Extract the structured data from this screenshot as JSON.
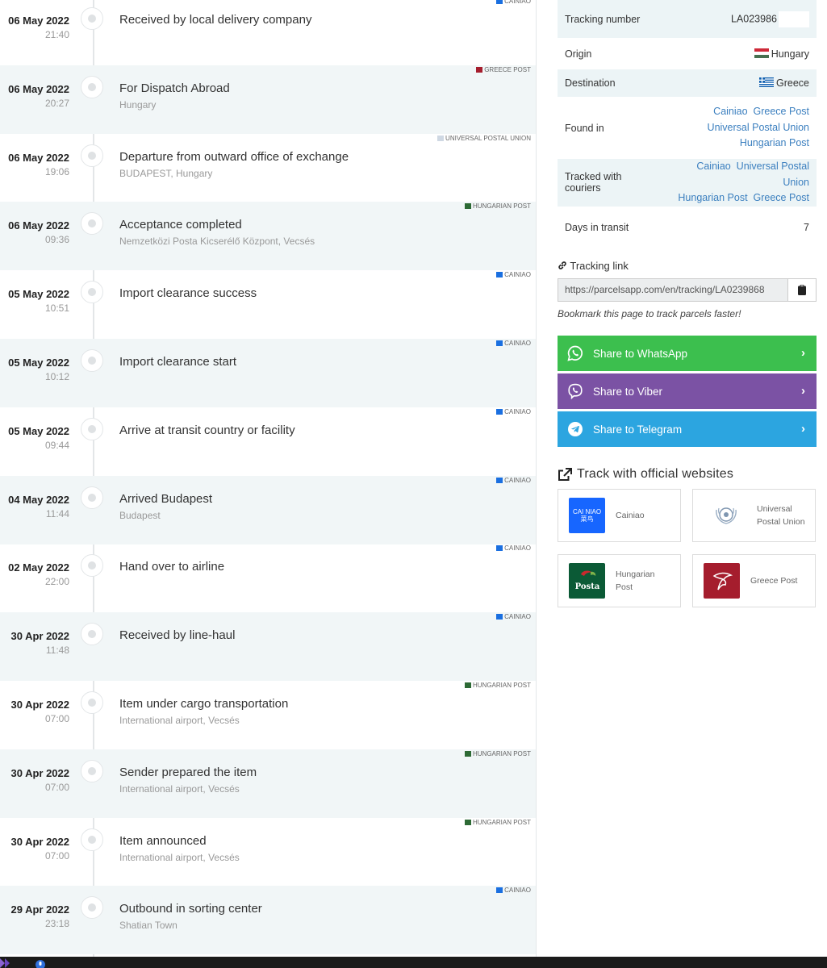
{
  "events": [
    {
      "date": "06 May 2022",
      "time": "21:40",
      "title": "Received by local delivery company",
      "location": "",
      "carrier": "CAINIAO",
      "carrier_color": "#1a6fe0"
    },
    {
      "date": "06 May 2022",
      "time": "20:27",
      "title": "For Dispatch Abroad",
      "location": "Hungary",
      "carrier": "GREECE POST",
      "carrier_color": "#a51d2d"
    },
    {
      "date": "06 May 2022",
      "time": "19:06",
      "title": "Departure from outward office of exchange",
      "location": "BUDAPEST, Hungary",
      "carrier": "UNIVERSAL POSTAL UNION",
      "carrier_color": "#cfd8e3"
    },
    {
      "date": "06 May 2022",
      "time": "09:36",
      "title": "Acceptance completed",
      "location": "Nemzetközi Posta Kicserélő Központ, Vecsés",
      "carrier": "HUNGARIAN POST",
      "carrier_color": "#2d6a35"
    },
    {
      "date": "05 May 2022",
      "time": "10:51",
      "title": "Import clearance success",
      "location": "",
      "carrier": "CAINIAO",
      "carrier_color": "#1a6fe0"
    },
    {
      "date": "05 May 2022",
      "time": "10:12",
      "title": "Import clearance start",
      "location": "",
      "carrier": "CAINIAO",
      "carrier_color": "#1a6fe0"
    },
    {
      "date": "05 May 2022",
      "time": "09:44",
      "title": "Arrive at transit country or facility",
      "location": "",
      "carrier": "CAINIAO",
      "carrier_color": "#1a6fe0"
    },
    {
      "date": "04 May 2022",
      "time": "11:44",
      "title": "Arrived Budapest",
      "location": "Budapest",
      "carrier": "CAINIAO",
      "carrier_color": "#1a6fe0"
    },
    {
      "date": "02 May 2022",
      "time": "22:00",
      "title": "Hand over to airline",
      "location": "",
      "carrier": "CAINIAO",
      "carrier_color": "#1a6fe0"
    },
    {
      "date": "30 Apr 2022",
      "time": "11:48",
      "title": "Received by line-haul",
      "location": "",
      "carrier": "CAINIAO",
      "carrier_color": "#1a6fe0"
    },
    {
      "date": "30 Apr 2022",
      "time": "07:00",
      "title": "Item under cargo transportation",
      "location": "International airport, Vecsés",
      "carrier": "HUNGARIAN POST",
      "carrier_color": "#2d6a35"
    },
    {
      "date": "30 Apr 2022",
      "time": "07:00",
      "title": "Sender prepared the item",
      "location": "International airport, Vecsés",
      "carrier": "HUNGARIAN POST",
      "carrier_color": "#2d6a35"
    },
    {
      "date": "30 Apr 2022",
      "time": "07:00",
      "title": "Item announced",
      "location": "International airport, Vecsés",
      "carrier": "HUNGARIAN POST",
      "carrier_color": "#2d6a35"
    },
    {
      "date": "29 Apr 2022",
      "time": "23:18",
      "title": "Outbound in sorting center",
      "location": "Shatian Town",
      "carrier": "CAINIAO",
      "carrier_color": "#1a6fe0"
    }
  ],
  "info": {
    "tracking_number_label": "Tracking number",
    "tracking_number": "LA023986",
    "origin_label": "Origin",
    "origin": "Hungary",
    "destination_label": "Destination",
    "destination": "Greece",
    "found_in_label": "Found in",
    "found_in": [
      "Cainiao",
      "Greece Post",
      "Universal Postal Union",
      "Hungarian Post"
    ],
    "tracked_with_label": "Tracked with couriers",
    "tracked_with": [
      "Cainiao",
      "Universal Postal Union",
      "Hungarian Post",
      "Greece Post"
    ],
    "days_label": "Days in transit",
    "days": "7"
  },
  "tracking_link": {
    "label": "Tracking link",
    "url": "https://parcelsapp.com/en/tracking/LA0239868",
    "hint": "Bookmark this page to track parcels faster!"
  },
  "share": {
    "whatsapp": "Share to WhatsApp",
    "viber": "Share to Viber",
    "telegram": "Share to Telegram",
    "whatsapp_color": "#3cbf4e",
    "viber_color": "#7b52a4",
    "telegram_color": "#2ca5e0"
  },
  "official": {
    "title": "Track with official websites",
    "cards": [
      {
        "name": "Cainiao",
        "logo_text": "CAI NIAO 菜鸟",
        "color": "#1766ff"
      },
      {
        "name": "Universal Postal Union",
        "logo_text": "",
        "color": "#ffffff"
      },
      {
        "name": "Hungarian Post",
        "logo_text": "Posta",
        "color": "#0b5a36"
      },
      {
        "name": "Greece Post",
        "logo_text": "",
        "color": "#a51d2d"
      }
    ]
  }
}
